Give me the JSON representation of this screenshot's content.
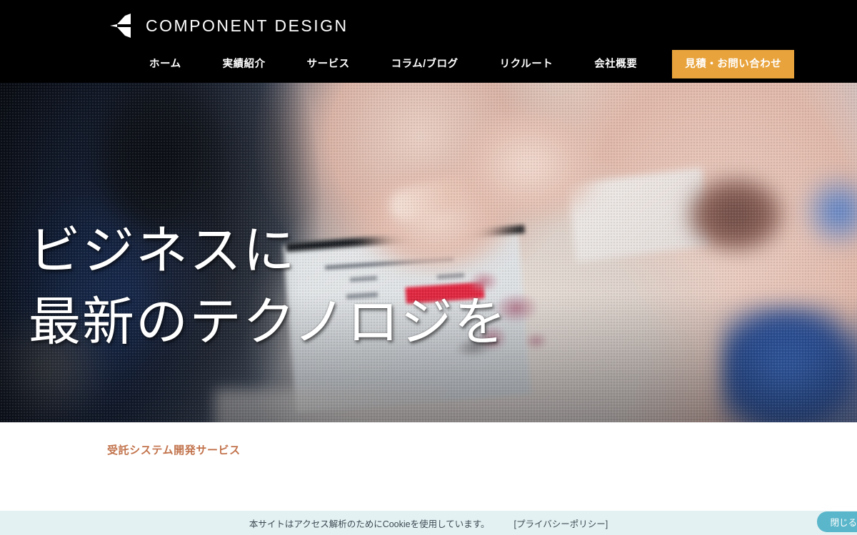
{
  "site": {
    "brand_name": "COMPONENT DESIGN",
    "logo_icon": "chevron-left-logo-icon",
    "accent_color": "#e8a33c",
    "header_bg": "#000000"
  },
  "nav": {
    "items": [
      {
        "label": "ホーム"
      },
      {
        "label": "実績紹介"
      },
      {
        "label": "サービス"
      },
      {
        "label": "コラム/ブログ"
      },
      {
        "label": "リクルート"
      },
      {
        "label": "会社概要"
      }
    ],
    "cta": {
      "label": "見積・お問い合わせ"
    }
  },
  "hero": {
    "line1": "ビジネスに",
    "line2": "最新のテクノロジを"
  },
  "content": {
    "section_title": "受託システム開発サービス",
    "section_title_color": "#c2734c"
  },
  "cookie": {
    "message": "本サイトはアクセス解析のためにCookieを使用しています。",
    "policy_link": "[プライバシーポリシー]",
    "close_label": "閉じる",
    "bar_color": "#e4f1f3",
    "button_color": "#5ab6ca"
  }
}
